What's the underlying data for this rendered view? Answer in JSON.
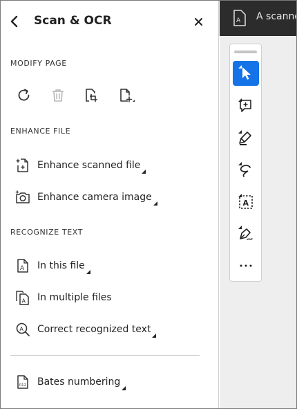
{
  "panel": {
    "title": "Scan & OCR",
    "sections": {
      "modify_page": "MODIFY PAGE",
      "enhance_file": "ENHANCE FILE",
      "recognize_text": "RECOGNIZE TEXT"
    },
    "modify_icons": [
      "rotate-icon",
      "delete-icon",
      "crop-page-icon",
      "insert-page-icon"
    ],
    "items": {
      "enhance_scanned": "Enhance scanned file",
      "enhance_camera": "Enhance camera image",
      "in_this_file": "In this file",
      "in_multiple_files": "In multiple files",
      "correct_text": "Correct recognized text",
      "bates": "Bates numbering"
    }
  },
  "document": {
    "tab_name": "A scanne"
  },
  "toolbar": {
    "tools": [
      "select-tool",
      "add-comment-tool",
      "highlight-tool",
      "draw-freeform-tool",
      "text-recognize-tool",
      "sign-tool",
      "more-tools"
    ],
    "active_tool": "select-tool"
  },
  "colors": {
    "accent": "#1473e6",
    "tab_bg": "#2c2c2c",
    "panel_bg": "#ffffff",
    "canvas_bg": "#eeeeee",
    "icon_disabled": "#b5b5b5"
  }
}
